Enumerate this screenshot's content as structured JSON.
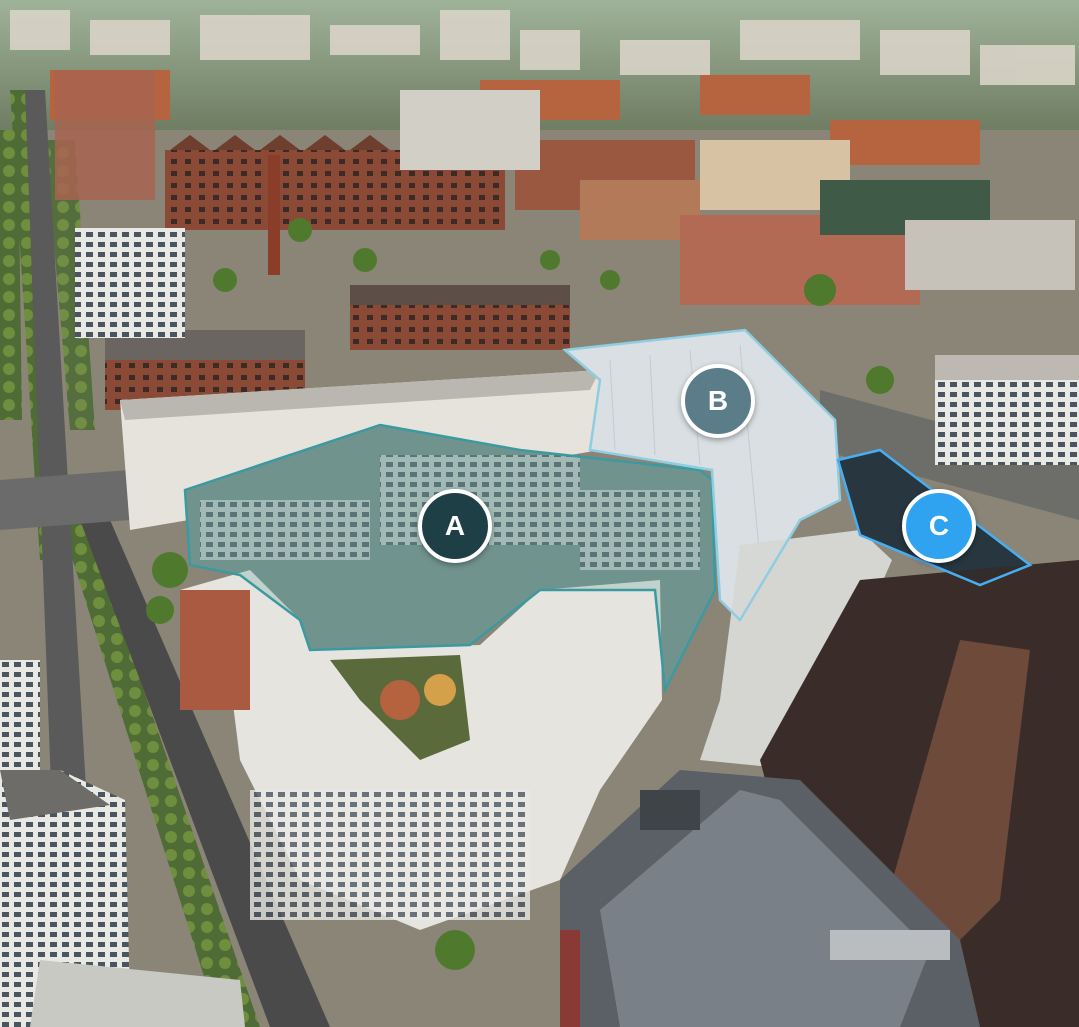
{
  "markers": [
    {
      "label": "A",
      "color": "#1e3f45"
    },
    {
      "label": "B",
      "color": "#5b7d8a"
    },
    {
      "label": "C",
      "color": "#2fa3ef"
    }
  ],
  "areas": {
    "a": {
      "fill": "#3f8f8a",
      "stroke": "#3b9aa0"
    },
    "b": {
      "fill": "#dfe9ef",
      "stroke": "#8fcde2"
    },
    "c": {
      "fill": "#1a2a36",
      "stroke": "#48aef2"
    }
  }
}
